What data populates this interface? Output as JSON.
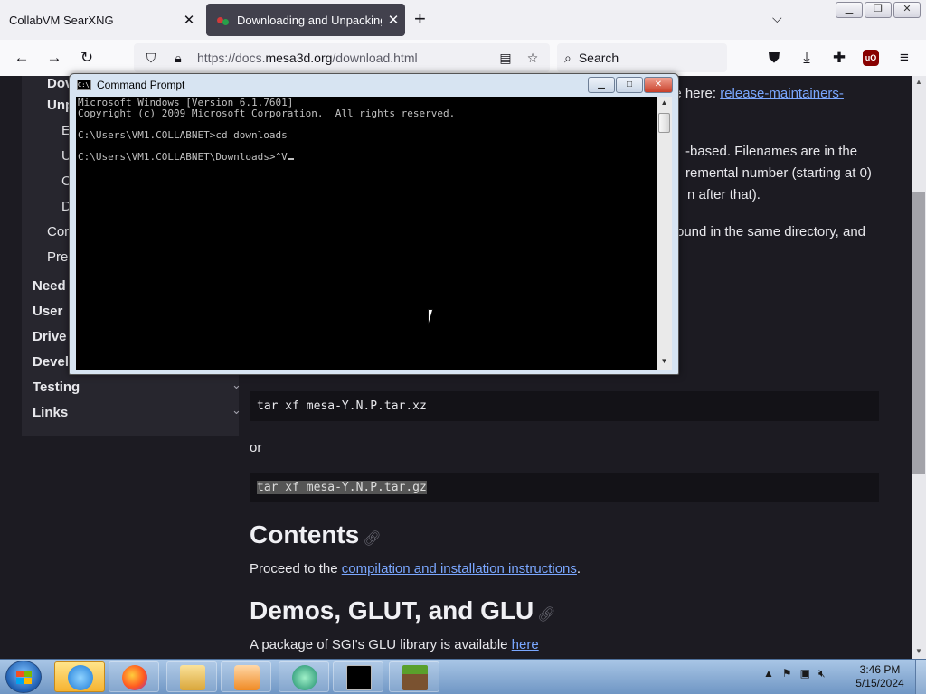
{
  "browser": {
    "tabs": [
      {
        "title": "CollabVM SearXNG",
        "active": false
      },
      {
        "title": "Downloading and Unpacking —",
        "active": true
      }
    ],
    "new_tab_label": "+",
    "url_prefix": "https://docs.",
    "url_domain": "mesa3d.org",
    "url_path": "/download.html",
    "search_placeholder": "Search",
    "ublock_label": "uO"
  },
  "sidebar": {
    "items": [
      {
        "label": "Dov",
        "bold": true
      },
      {
        "label": "Unp",
        "bold": true
      },
      {
        "label": "E",
        "bold": false
      },
      {
        "label": "U",
        "bold": false
      },
      {
        "label": "C",
        "bold": false
      },
      {
        "label": "D",
        "bold": false
      },
      {
        "label": "Cor",
        "bold": false
      },
      {
        "label": "Pre",
        "bold": false
      },
      {
        "label": "Need",
        "bold": true
      },
      {
        "label": "User",
        "bold": true
      },
      {
        "label": "Drive",
        "bold": true
      },
      {
        "label": "Devel",
        "bold": true
      },
      {
        "label": "Testing",
        "bold": true
      },
      {
        "label": "Links",
        "bold": true
      }
    ]
  },
  "content": {
    "line1_text": "le here: ",
    "line1_link": "release-maintainers-",
    "line2": "-based. Filenames are in the",
    "line3": "remental number (starting at 0)",
    "line4": "n after that).",
    "line5": "ound in the same directory, and",
    "code1": "tar xf mesa-Y.N.P.tar.xz",
    "or_text": "or",
    "code2": "tar xf mesa-Y.N.P.tar.gz",
    "h_contents": "Contents",
    "proceed_text": "Proceed to the ",
    "proceed_link": "compilation and installation instructions",
    "proceed_end": ".",
    "h_demos": "Demos, GLUT, and GLU",
    "package_text": "A package of SGI's GLU library is available ",
    "package_link": "here"
  },
  "cmd": {
    "title": "Command Prompt",
    "lines": [
      "Microsoft Windows [Version 6.1.7601]",
      "Copyright (c) 2009 Microsoft Corporation.  All rights reserved.",
      "",
      "C:\\Users\\VM1.COLLABNET>cd downloads",
      "",
      "C:\\Users\\VM1.COLLABNET\\Downloads>^V"
    ]
  },
  "taskbar": {
    "time": "3:46 PM",
    "date": "5/15/2024",
    "items": [
      "internet-explorer",
      "firefox",
      "file-explorer",
      "media-player",
      "browser-app",
      "command-prompt",
      "minecraft"
    ]
  }
}
